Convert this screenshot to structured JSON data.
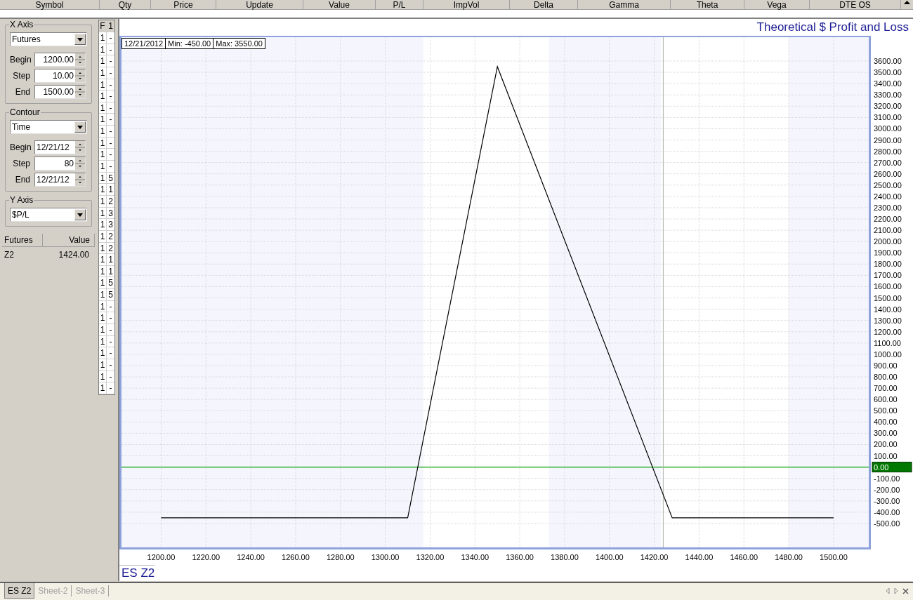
{
  "table": {
    "columns": [
      "Symbol",
      "Qty",
      "Price",
      "Update",
      "Value",
      "P/L",
      "ImpVol",
      "Delta",
      "Gamma",
      "Theta",
      "Vega",
      "DTE OS"
    ]
  },
  "x_axis_group": {
    "title": "X Axis",
    "dropdown": "Futures",
    "fields": [
      {
        "label": "Begin",
        "value": "1200.00"
      },
      {
        "label": "Step",
        "value": "10.00"
      },
      {
        "label": "End",
        "value": "1500.00"
      }
    ]
  },
  "contour_group": {
    "title": "Contour",
    "dropdown": "Time",
    "fields": [
      {
        "label": "Begin",
        "value": "12/21/12"
      },
      {
        "label": "Step",
        "value": "80"
      },
      {
        "label": "End",
        "value": "12/21/12"
      }
    ]
  },
  "y_axis_group": {
    "title": "Y Axis",
    "dropdown": "$P/L"
  },
  "futures_table": {
    "columns": [
      "Futures",
      "Value"
    ],
    "rows": [
      [
        "Z2",
        "1424.00"
      ]
    ]
  },
  "side_grid": {
    "columns": [
      "F",
      "1"
    ],
    "rows": [
      [
        "1",
        "-"
      ],
      [
        "1",
        "-"
      ],
      [
        "1",
        "-"
      ],
      [
        "1",
        "-"
      ],
      [
        "1",
        "-"
      ],
      [
        "1",
        "-"
      ],
      [
        "1",
        "-"
      ],
      [
        "1",
        "-"
      ],
      [
        "1",
        "-"
      ],
      [
        "1",
        "-"
      ],
      [
        "1",
        "-"
      ],
      [
        "1",
        "-"
      ],
      [
        "1",
        "5"
      ],
      [
        "1",
        "1"
      ],
      [
        "1",
        "2"
      ],
      [
        "1",
        "3"
      ],
      [
        "1",
        "3"
      ],
      [
        "1",
        "2"
      ],
      [
        "1",
        "2"
      ],
      [
        "1",
        "1"
      ],
      [
        "1",
        "1"
      ],
      [
        "1",
        "5"
      ],
      [
        "1",
        "5"
      ],
      [
        "1",
        "-"
      ],
      [
        "1",
        "-"
      ],
      [
        "1",
        "-"
      ],
      [
        "1",
        "-"
      ],
      [
        "1",
        "-"
      ],
      [
        "1",
        "-"
      ],
      [
        "1",
        "-"
      ],
      [
        "1",
        "-"
      ]
    ]
  },
  "chart": {
    "title": "Theoretical $ Profit and Loss",
    "legend": [
      "Min: -450.00",
      "Max: 3550.00"
    ],
    "chart_data": {
      "type": "line",
      "x": [
        1200,
        1310,
        1350,
        1428,
        1500
      ],
      "series": [
        {
          "name": "12/21/2012",
          "color": "#000000",
          "values": [
            -450,
            -450,
            3550,
            -450,
            -450
          ]
        }
      ],
      "xlim": [
        1182,
        1516
      ],
      "ylim": [
        -718,
        3824
      ],
      "xticks": [
        {
          "value": 1200,
          "label": "1200.00"
        },
        {
          "value": 1220,
          "label": "1220.00"
        },
        {
          "value": 1240,
          "label": "1240.00"
        },
        {
          "value": 1260,
          "label": "1260.00"
        },
        {
          "value": 1280,
          "label": "1280.00"
        },
        {
          "value": 1300,
          "label": "1300.00"
        },
        {
          "value": 1320,
          "label": "1320.00"
        },
        {
          "value": 1340,
          "label": "1340.00"
        },
        {
          "value": 1360,
          "label": "1360.00"
        },
        {
          "value": 1380,
          "label": "1380.00"
        },
        {
          "value": 1400,
          "label": "1400.00"
        },
        {
          "value": 1420,
          "label": "1420.00"
        },
        {
          "value": 1440,
          "label": "1440.00"
        },
        {
          "value": 1460,
          "label": "1460.00"
        },
        {
          "value": 1480,
          "label": "1480.00"
        },
        {
          "value": 1500,
          "label": "1500.00"
        }
      ],
      "yticks": [
        {
          "value": 3600,
          "label": "3600.00"
        },
        {
          "value": 3500,
          "label": "3500.00"
        },
        {
          "value": 3400,
          "label": "3400.00"
        },
        {
          "value": 3300,
          "label": "3300.00"
        },
        {
          "value": 3200,
          "label": "3200.00"
        },
        {
          "value": 3100,
          "label": "3100.00"
        },
        {
          "value": 3000,
          "label": "3000.00"
        },
        {
          "value": 2900,
          "label": "2900.00"
        },
        {
          "value": 2800,
          "label": "2800.00"
        },
        {
          "value": 2700,
          "label": "2700.00"
        },
        {
          "value": 2600,
          "label": "2600.00"
        },
        {
          "value": 2500,
          "label": "2500.00"
        },
        {
          "value": 2400,
          "label": "2400.00"
        },
        {
          "value": 2300,
          "label": "2300.00"
        },
        {
          "value": 2200,
          "label": "2200.00"
        },
        {
          "value": 2100,
          "label": "2100.00"
        },
        {
          "value": 2000,
          "label": "2000.00"
        },
        {
          "value": 1900,
          "label": "1900.00"
        },
        {
          "value": 1800,
          "label": "1800.00"
        },
        {
          "value": 1700,
          "label": "1700.00"
        },
        {
          "value": 1600,
          "label": "1600.00"
        },
        {
          "value": 1500,
          "label": "1500.00"
        },
        {
          "value": 1400,
          "label": "1400.00"
        },
        {
          "value": 1300,
          "label": "1300.00"
        },
        {
          "value": 1200,
          "label": "1200.00"
        },
        {
          "value": 1100,
          "label": "1100.00"
        },
        {
          "value": 1000,
          "label": "1000.00"
        },
        {
          "value": 900,
          "label": "900.00"
        },
        {
          "value": 800,
          "label": "800.00"
        },
        {
          "value": 700,
          "label": "700.00"
        },
        {
          "value": 600,
          "label": "600.00"
        },
        {
          "value": 500,
          "label": "500.00"
        },
        {
          "value": 400,
          "label": "400.00"
        },
        {
          "value": 300,
          "label": "300.00"
        },
        {
          "value": 200,
          "label": "200.00"
        },
        {
          "value": 100,
          "label": "100.00"
        },
        {
          "value": 0,
          "label": "0.00"
        },
        {
          "value": -100,
          "label": "-100.00"
        },
        {
          "value": -200,
          "label": "-200.00"
        },
        {
          "value": -300,
          "label": "-300.00"
        },
        {
          "value": -400,
          "label": "-400.00"
        },
        {
          "value": -500,
          "label": "-500.00"
        }
      ],
      "grid": true,
      "ref_lines": [
        {
          "axis": "y",
          "value": 0,
          "color": "#00a000"
        },
        {
          "axis": "x",
          "value": 1424,
          "color": "#b0b0b0"
        }
      ],
      "bands": [
        {
          "axis": "x",
          "from": 1182,
          "to": 1317,
          "color": "#f5f5fd"
        },
        {
          "axis": "x",
          "from": 1373,
          "to": 1423,
          "color": "#f5f5fd"
        },
        {
          "axis": "x",
          "from": 1480,
          "to": 1516,
          "color": "#f5f5fd"
        }
      ]
    },
    "footer": "ES Z2"
  },
  "sheet_tabs": [
    {
      "label": "ES Z2",
      "selected": true
    },
    {
      "label": "Sheet-2",
      "selected": false
    },
    {
      "label": "Sheet-3",
      "selected": false
    }
  ]
}
